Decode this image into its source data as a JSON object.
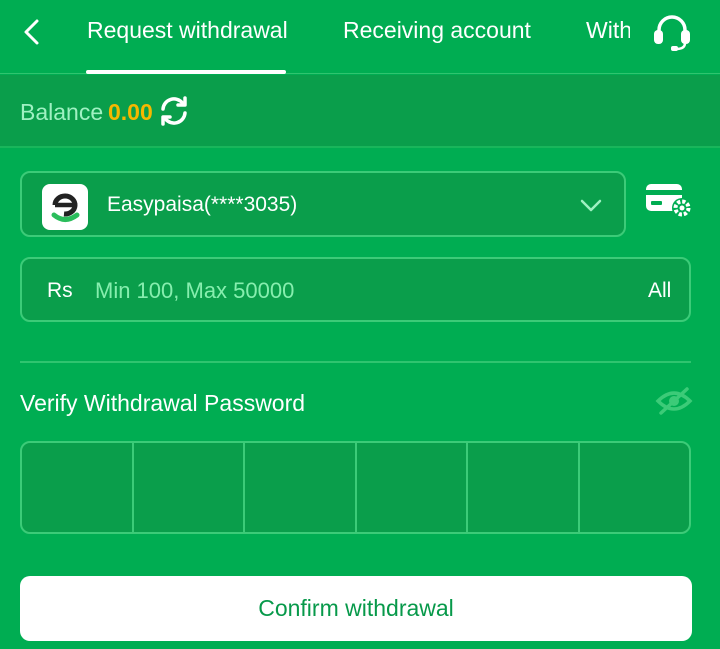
{
  "header": {
    "tabs": [
      {
        "label": "Request withdrawal",
        "active": true
      },
      {
        "label": "Receiving account",
        "active": false
      },
      {
        "label": "With",
        "active": false
      }
    ],
    "back_icon": "chevron-left-icon",
    "support_icon": "headset-icon"
  },
  "balance": {
    "label": "Balance",
    "value": "0.00",
    "refresh_icon": "refresh-icon"
  },
  "account": {
    "selected": "Easypaisa(****3035)",
    "logo": "easypaisa-logo",
    "settings_icon": "card-settings-icon"
  },
  "amount": {
    "currency": "Rs",
    "placeholder": "Min 100, Max 50000",
    "all_label": "All"
  },
  "password": {
    "label": "Verify Withdrawal Password",
    "visibility_icon": "eye-off-icon",
    "digits": 6
  },
  "confirm_label": "Confirm withdrawal",
  "colors": {
    "background": "#00ad52",
    "panel": "#0a9e4b",
    "accent": "#f5b800",
    "button_text": "#07994a"
  }
}
